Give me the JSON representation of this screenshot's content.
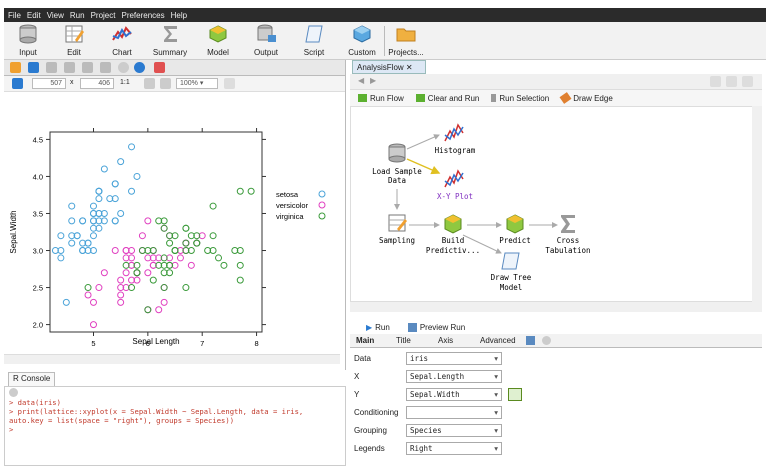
{
  "menu": [
    "File",
    "Edit",
    "View",
    "Run",
    "Project",
    "Preferences",
    "Help"
  ],
  "toolbar": {
    "buttons": [
      "Input",
      "Edit",
      "Chart",
      "Summary",
      "Model",
      "Output",
      "Script",
      "Custom",
      "Projects..."
    ]
  },
  "plot_toolbar": {
    "width": "507",
    "x_sep": "x",
    "height": "406",
    "ratio": "1:1",
    "zoom": "100%"
  },
  "plot": {
    "xlabel": "Sepal Length",
    "ylabel": "Sepal.Width",
    "xticks": [
      "5",
      "6",
      "7",
      "8"
    ],
    "yticks": [
      "2.0",
      "2.5",
      "3.0",
      "3.5",
      "4.0",
      "4.5"
    ],
    "legend": [
      {
        "name": "setosa",
        "color": "#4aa3d8"
      },
      {
        "name": "versicolor",
        "color": "#e040c0"
      },
      {
        "name": "virginica",
        "color": "#3a9a3a"
      }
    ],
    "colors": {
      "setosa": "#4aa3d8",
      "versicolor": "#e040c0",
      "virginica": "#3a9a3a"
    }
  },
  "chart_data": {
    "type": "scatter",
    "xlabel": "Sepal Length",
    "ylabel": "Sepal.Width",
    "xlim": [
      4.2,
      8.1
    ],
    "ylim": [
      1.9,
      4.6
    ],
    "series": [
      {
        "name": "setosa",
        "points": [
          [
            5.1,
            3.5
          ],
          [
            4.9,
            3.0
          ],
          [
            4.7,
            3.2
          ],
          [
            4.6,
            3.1
          ],
          [
            5.0,
            3.6
          ],
          [
            5.4,
            3.9
          ],
          [
            4.6,
            3.4
          ],
          [
            5.0,
            3.4
          ],
          [
            4.4,
            2.9
          ],
          [
            4.9,
            3.1
          ],
          [
            5.4,
            3.7
          ],
          [
            4.8,
            3.4
          ],
          [
            4.8,
            3.0
          ],
          [
            4.3,
            3.0
          ],
          [
            5.8,
            4.0
          ],
          [
            5.7,
            4.4
          ],
          [
            5.4,
            3.9
          ],
          [
            5.1,
            3.5
          ],
          [
            5.7,
            3.8
          ],
          [
            5.1,
            3.8
          ],
          [
            5.4,
            3.4
          ],
          [
            5.1,
            3.7
          ],
          [
            4.6,
            3.6
          ],
          [
            5.1,
            3.3
          ],
          [
            4.8,
            3.4
          ],
          [
            5.0,
            3.0
          ],
          [
            5.0,
            3.4
          ],
          [
            5.2,
            3.5
          ],
          [
            5.2,
            3.4
          ],
          [
            4.7,
            3.2
          ],
          [
            4.8,
            3.1
          ],
          [
            5.4,
            3.4
          ],
          [
            5.2,
            4.1
          ],
          [
            5.5,
            4.2
          ],
          [
            4.9,
            3.1
          ],
          [
            5.0,
            3.2
          ],
          [
            5.5,
            3.5
          ],
          [
            4.4,
            3.0
          ],
          [
            5.1,
            3.4
          ],
          [
            5.0,
            3.5
          ],
          [
            4.5,
            2.3
          ],
          [
            4.4,
            3.2
          ],
          [
            5.0,
            3.5
          ],
          [
            5.1,
            3.8
          ],
          [
            4.8,
            3.0
          ],
          [
            5.1,
            3.8
          ],
          [
            4.6,
            3.2
          ],
          [
            5.3,
            3.7
          ],
          [
            5.0,
            3.3
          ]
        ]
      },
      {
        "name": "versicolor",
        "points": [
          [
            7.0,
            3.2
          ],
          [
            6.4,
            3.2
          ],
          [
            6.9,
            3.1
          ],
          [
            5.5,
            2.3
          ],
          [
            6.5,
            2.8
          ],
          [
            5.7,
            2.8
          ],
          [
            6.3,
            3.3
          ],
          [
            4.9,
            2.4
          ],
          [
            6.6,
            2.9
          ],
          [
            5.2,
            2.7
          ],
          [
            5.0,
            2.0
          ],
          [
            5.9,
            3.0
          ],
          [
            6.0,
            2.2
          ],
          [
            6.1,
            2.9
          ],
          [
            5.6,
            2.9
          ],
          [
            6.7,
            3.1
          ],
          [
            5.6,
            3.0
          ],
          [
            5.8,
            2.7
          ],
          [
            6.2,
            2.2
          ],
          [
            5.6,
            2.5
          ],
          [
            5.9,
            3.2
          ],
          [
            6.1,
            2.8
          ],
          [
            6.3,
            2.5
          ],
          [
            6.1,
            2.8
          ],
          [
            6.4,
            2.9
          ],
          [
            6.6,
            3.0
          ],
          [
            6.8,
            2.8
          ],
          [
            6.7,
            3.0
          ],
          [
            6.0,
            2.9
          ],
          [
            5.7,
            2.6
          ],
          [
            5.5,
            2.4
          ],
          [
            5.8,
            2.7
          ],
          [
            6.0,
            2.7
          ],
          [
            5.4,
            3.0
          ],
          [
            6.0,
            3.4
          ],
          [
            6.7,
            3.1
          ],
          [
            6.3,
            2.3
          ],
          [
            5.6,
            3.0
          ],
          [
            5.5,
            2.5
          ],
          [
            5.5,
            2.6
          ],
          [
            6.1,
            3.0
          ],
          [
            5.8,
            2.6
          ],
          [
            5.0,
            2.3
          ],
          [
            5.6,
            2.7
          ],
          [
            5.7,
            3.0
          ],
          [
            5.7,
            2.9
          ],
          [
            6.2,
            2.9
          ],
          [
            5.1,
            2.5
          ],
          [
            5.7,
            2.8
          ]
        ]
      },
      {
        "name": "virginica",
        "points": [
          [
            6.3,
            3.3
          ],
          [
            5.8,
            2.7
          ],
          [
            7.1,
            3.0
          ],
          [
            6.3,
            2.9
          ],
          [
            6.5,
            3.0
          ],
          [
            7.6,
            3.0
          ],
          [
            4.9,
            2.5
          ],
          [
            7.3,
            2.9
          ],
          [
            6.7,
            2.5
          ],
          [
            7.2,
            3.6
          ],
          [
            6.5,
            3.2
          ],
          [
            6.4,
            2.7
          ],
          [
            6.8,
            3.0
          ],
          [
            5.7,
            2.5
          ],
          [
            5.8,
            2.8
          ],
          [
            6.4,
            3.2
          ],
          [
            6.5,
            3.0
          ],
          [
            7.7,
            3.8
          ],
          [
            7.7,
            2.6
          ],
          [
            6.0,
            2.2
          ],
          [
            6.9,
            3.2
          ],
          [
            5.6,
            2.8
          ],
          [
            7.7,
            2.8
          ],
          [
            6.3,
            2.7
          ],
          [
            6.7,
            3.3
          ],
          [
            7.2,
            3.2
          ],
          [
            6.2,
            2.8
          ],
          [
            6.1,
            3.0
          ],
          [
            6.4,
            2.8
          ],
          [
            7.2,
            3.0
          ],
          [
            7.4,
            2.8
          ],
          [
            7.9,
            3.8
          ],
          [
            6.4,
            2.8
          ],
          [
            6.3,
            2.8
          ],
          [
            6.1,
            2.6
          ],
          [
            7.7,
            3.0
          ],
          [
            6.3,
            3.4
          ],
          [
            6.4,
            3.1
          ],
          [
            6.0,
            3.0
          ],
          [
            6.9,
            3.1
          ],
          [
            6.7,
            3.1
          ],
          [
            6.9,
            3.1
          ],
          [
            5.8,
            2.7
          ],
          [
            6.8,
            3.2
          ],
          [
            6.7,
            3.3
          ],
          [
            6.7,
            3.0
          ],
          [
            6.3,
            2.5
          ],
          [
            6.5,
            3.0
          ],
          [
            6.2,
            3.4
          ],
          [
            5.9,
            3.0
          ]
        ]
      }
    ],
    "legend": [
      "setosa",
      "versicolor",
      "virginica"
    ],
    "legend_position": "right",
    "grid": false
  },
  "console": {
    "tab": "R Console",
    "lines": [
      "> data(iris)",
      "> print(lattice::xyplot(x = Sepal.Width ~ Sepal.Length, data = iris,",
      "auto.key = list(space = \"right\"), groups = Species))",
      ">"
    ]
  },
  "flow": {
    "tab": "AnalysisFlow",
    "actions": [
      "Run Flow",
      "Clear and Run",
      "Run Selection",
      "Draw Edge"
    ],
    "nodes": [
      {
        "id": "load",
        "label": "Load Sample\nData"
      },
      {
        "id": "hist",
        "label": "Histogram"
      },
      {
        "id": "xy",
        "label": "X-Y Plot"
      },
      {
        "id": "sampling",
        "label": "Sampling"
      },
      {
        "id": "build",
        "label": "Build\nPredictiv..."
      },
      {
        "id": "predict",
        "label": "Predict"
      },
      {
        "id": "cross",
        "label": "Cross\nTabulation"
      },
      {
        "id": "tree",
        "label": "Draw Tree\nModel"
      }
    ]
  },
  "run": {
    "run_label": "Run",
    "preview_label": "Preview Run"
  },
  "prop_tabs": [
    "Main",
    "Title",
    "Axis",
    "Advanced"
  ],
  "props": [
    {
      "label": "Data",
      "value": "iris"
    },
    {
      "label": "X",
      "value": "Sepal.Length"
    },
    {
      "label": "Y",
      "value": "Sepal.Width"
    },
    {
      "label": "Conditioning",
      "value": ""
    },
    {
      "label": "Grouping",
      "value": "Species"
    },
    {
      "label": "Legends",
      "value": "Right"
    }
  ]
}
